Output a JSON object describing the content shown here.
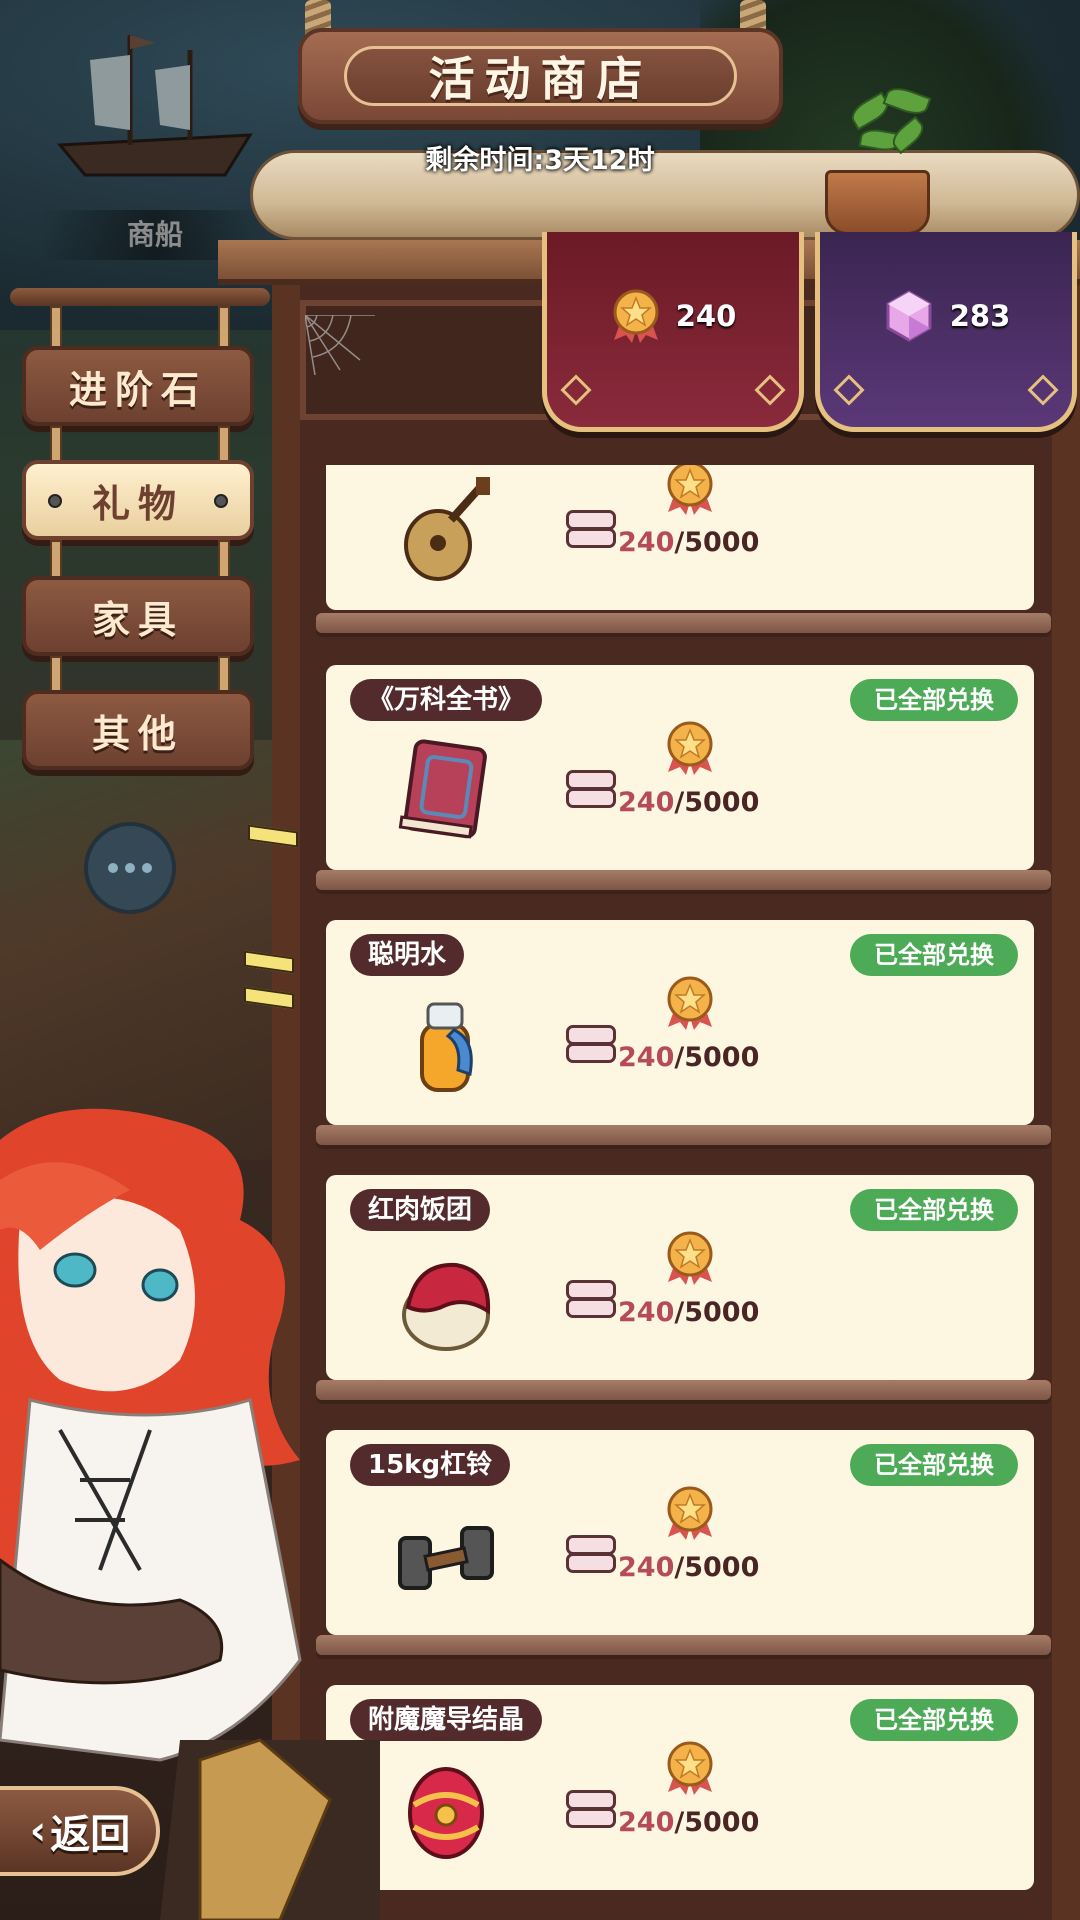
{
  "shop": {
    "title": "活动商店",
    "timer": "剩余时间:3天12时"
  },
  "background": {
    "ship_label": "商船"
  },
  "currencies": [
    {
      "icon": "medal-icon",
      "amount": "240",
      "color": "#8a2a3c"
    },
    {
      "icon": "gem-icon",
      "amount": "283",
      "color": "#5b3878"
    }
  ],
  "tabs": [
    {
      "label": "进阶石",
      "active": false
    },
    {
      "label": "礼物",
      "active": true
    },
    {
      "label": "家具",
      "active": false
    },
    {
      "label": "其他",
      "active": false
    }
  ],
  "items": [
    {
      "name": "",
      "icon": "lute-icon",
      "status": "",
      "have": "240",
      "need": "/5000"
    },
    {
      "name": "《万科全书》",
      "icon": "book-icon",
      "status": "已全部兑换",
      "have": "240",
      "need": "/5000"
    },
    {
      "name": "聪明水",
      "icon": "potion-icon",
      "status": "已全部兑换",
      "have": "240",
      "need": "/5000"
    },
    {
      "name": "红肉饭团",
      "icon": "rice-ball-icon",
      "status": "已全部兑换",
      "have": "240",
      "need": "/5000"
    },
    {
      "name": "15kg杠铃",
      "icon": "dumbbell-icon",
      "status": "已全部兑换",
      "have": "240",
      "need": "/5000"
    },
    {
      "name": "附魔魔导结晶",
      "icon": "crystal-egg-icon",
      "status": "已全部兑换",
      "have": "240",
      "need": "/5000"
    }
  ],
  "back_button": {
    "label": "返回"
  }
}
